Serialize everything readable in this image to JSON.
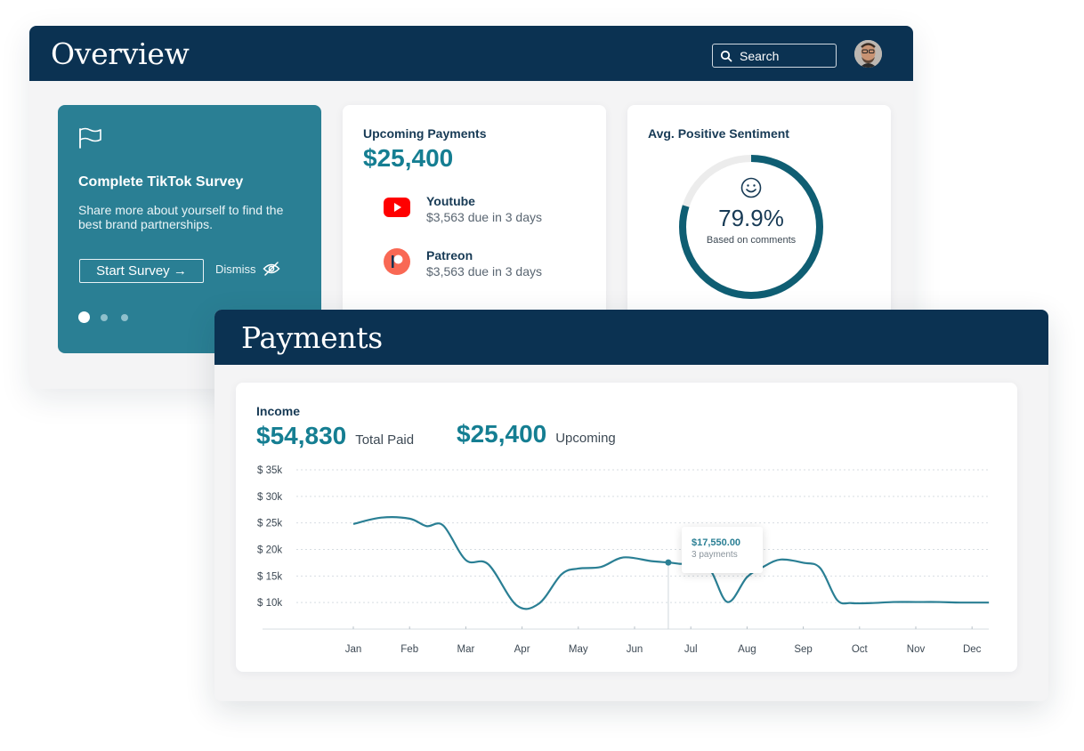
{
  "overview": {
    "title": "Overview",
    "search_placeholder": "Search",
    "survey": {
      "title": "Complete TikTok Survey",
      "text": "Share more about yourself to find the best brand partnerships.",
      "start_label": "Start Survey →",
      "dismiss_label": "Dismiss",
      "pages": 3,
      "active_page": 1
    },
    "upcoming": {
      "title": "Upcoming Payments",
      "amount": "$25,400",
      "items": [
        {
          "name": "Youtube",
          "due": "$3,563 due in 3 days",
          "icon": "youtube-icon"
        },
        {
          "name": "Patreon",
          "due": "$3,563 due in 3 days",
          "icon": "patreon-icon"
        }
      ]
    },
    "sentiment": {
      "title": "Avg. Positive Sentiment",
      "value_label": "79.9%",
      "value": 0.799,
      "caption": "Based on comments"
    }
  },
  "payments": {
    "title": "Payments",
    "income_label": "Income",
    "total_paid_amount": "$54,830",
    "total_paid_label": "Total Paid",
    "upcoming_amount": "$25,400",
    "upcoming_label": "Upcoming",
    "tooltip": {
      "value": "$17,550.00",
      "sub": "3 payments"
    }
  },
  "colors": {
    "navy": "#0b3252",
    "teal": "#2a7f94",
    "teal_text": "#157e92",
    "youtube": "#ff0000",
    "patreon": "#f96854"
  },
  "chart_data": {
    "type": "line",
    "ylabel": "",
    "xlabel": "",
    "y_ticks": [
      "$ 10k",
      "$ 15k",
      "$ 20k",
      "$ 25k",
      "$ 30k",
      "$ 35k"
    ],
    "y_tick_values": [
      10000,
      15000,
      20000,
      25000,
      30000,
      35000
    ],
    "ylim": [
      5000,
      35000
    ],
    "categories": [
      "Jan",
      "Feb",
      "Mar",
      "Apr",
      "May",
      "Jun",
      "Jul",
      "Aug",
      "Sep",
      "Oct",
      "Nov",
      "Dec"
    ],
    "x": [
      0.0,
      0.5,
      1.0,
      1.3,
      1.6,
      2.0,
      2.4,
      2.9,
      3.3,
      3.7,
      4.0,
      4.4,
      4.8,
      5.3,
      5.6,
      5.8,
      6.3,
      6.65,
      7.0,
      7.3,
      7.6,
      8.0,
      8.3,
      8.6,
      8.85,
      9.2,
      9.6,
      10.0,
      10.4,
      10.8,
      11.3
    ],
    "values": [
      24800,
      26000,
      25800,
      24400,
      24500,
      18000,
      17200,
      9500,
      9800,
      15300,
      16400,
      16700,
      18500,
      17800,
      17550,
      17300,
      16700,
      10100,
      14800,
      16800,
      18100,
      17500,
      16500,
      10500,
      9900,
      9900,
      10100,
      10100,
      10100,
      10000,
      10000
    ],
    "highlight": {
      "x": 5.6,
      "value": 17550
    },
    "grid": "horizontal dotted",
    "legend": "none"
  }
}
